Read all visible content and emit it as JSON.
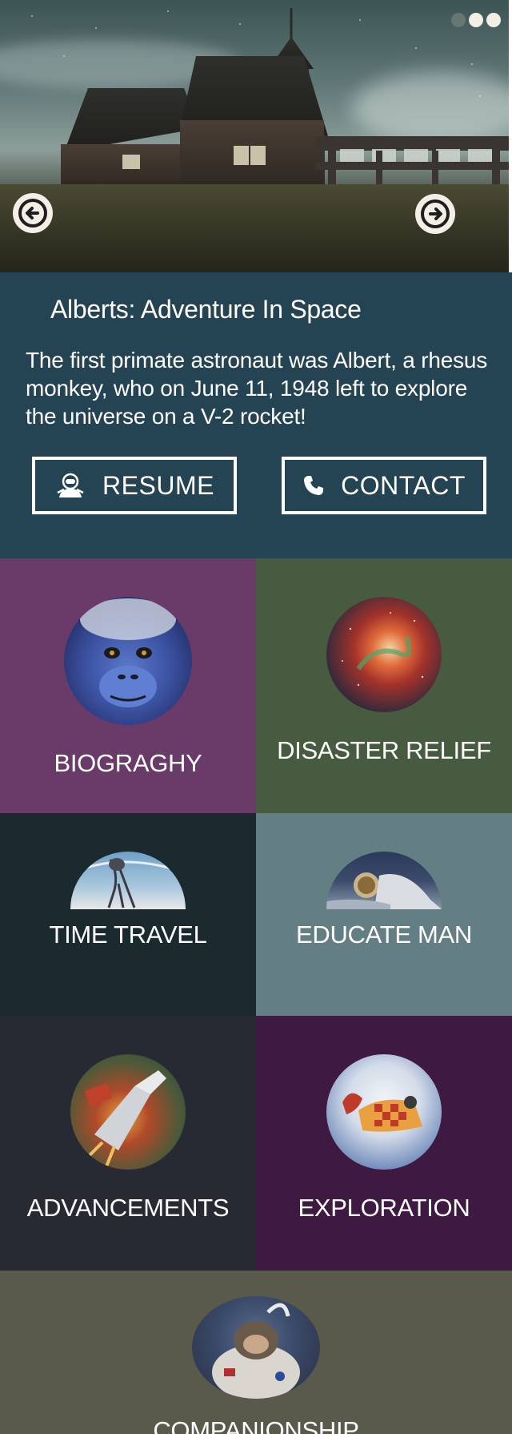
{
  "hero": {
    "slides": [
      {
        "name": "slide-1",
        "active": false
      },
      {
        "name": "slide-2",
        "active": true
      },
      {
        "name": "slide-3",
        "active": true
      }
    ],
    "prev_icon": "arrow-circle-left-icon",
    "next_icon": "arrow-circle-right-icon"
  },
  "intro": {
    "title": "Alberts: Adventure In Space",
    "description": "The first primate astronaut was Albert, a rhesus monkey, who on June 11, 1948 left to explore the universe on a V-2 rocket!",
    "resume_label": "RESUME",
    "resume_icon": "astronaut-icon",
    "contact_label": "CONTACT",
    "contact_icon": "phone-icon"
  },
  "tiles": [
    {
      "label": "BIOGRAGHY",
      "image": "chimpanzee-portrait",
      "color": "#6a3b68"
    },
    {
      "label": "DISASTER RELIEF",
      "image": "orion-nebula",
      "color": "#465b3f"
    },
    {
      "label": "TIME TRAVEL",
      "image": "alien-walker",
      "color": "#1b2a2f"
    },
    {
      "label": "EDUCATE MAN",
      "image": "astronaut-moon",
      "color": "#637f83"
    },
    {
      "label": "ADVANCEMENTS",
      "image": "space-fighter",
      "color": "#272a33"
    },
    {
      "label": "EXPLORATION",
      "image": "retro-rover",
      "color": "#3e1a42"
    },
    {
      "label": "COMPANIONSHIP",
      "image": "monkey-astronaut",
      "color": "#5a5a4c"
    }
  ],
  "colors": {
    "intro_bg": "#254453",
    "accent_light": "#f4efe6"
  }
}
